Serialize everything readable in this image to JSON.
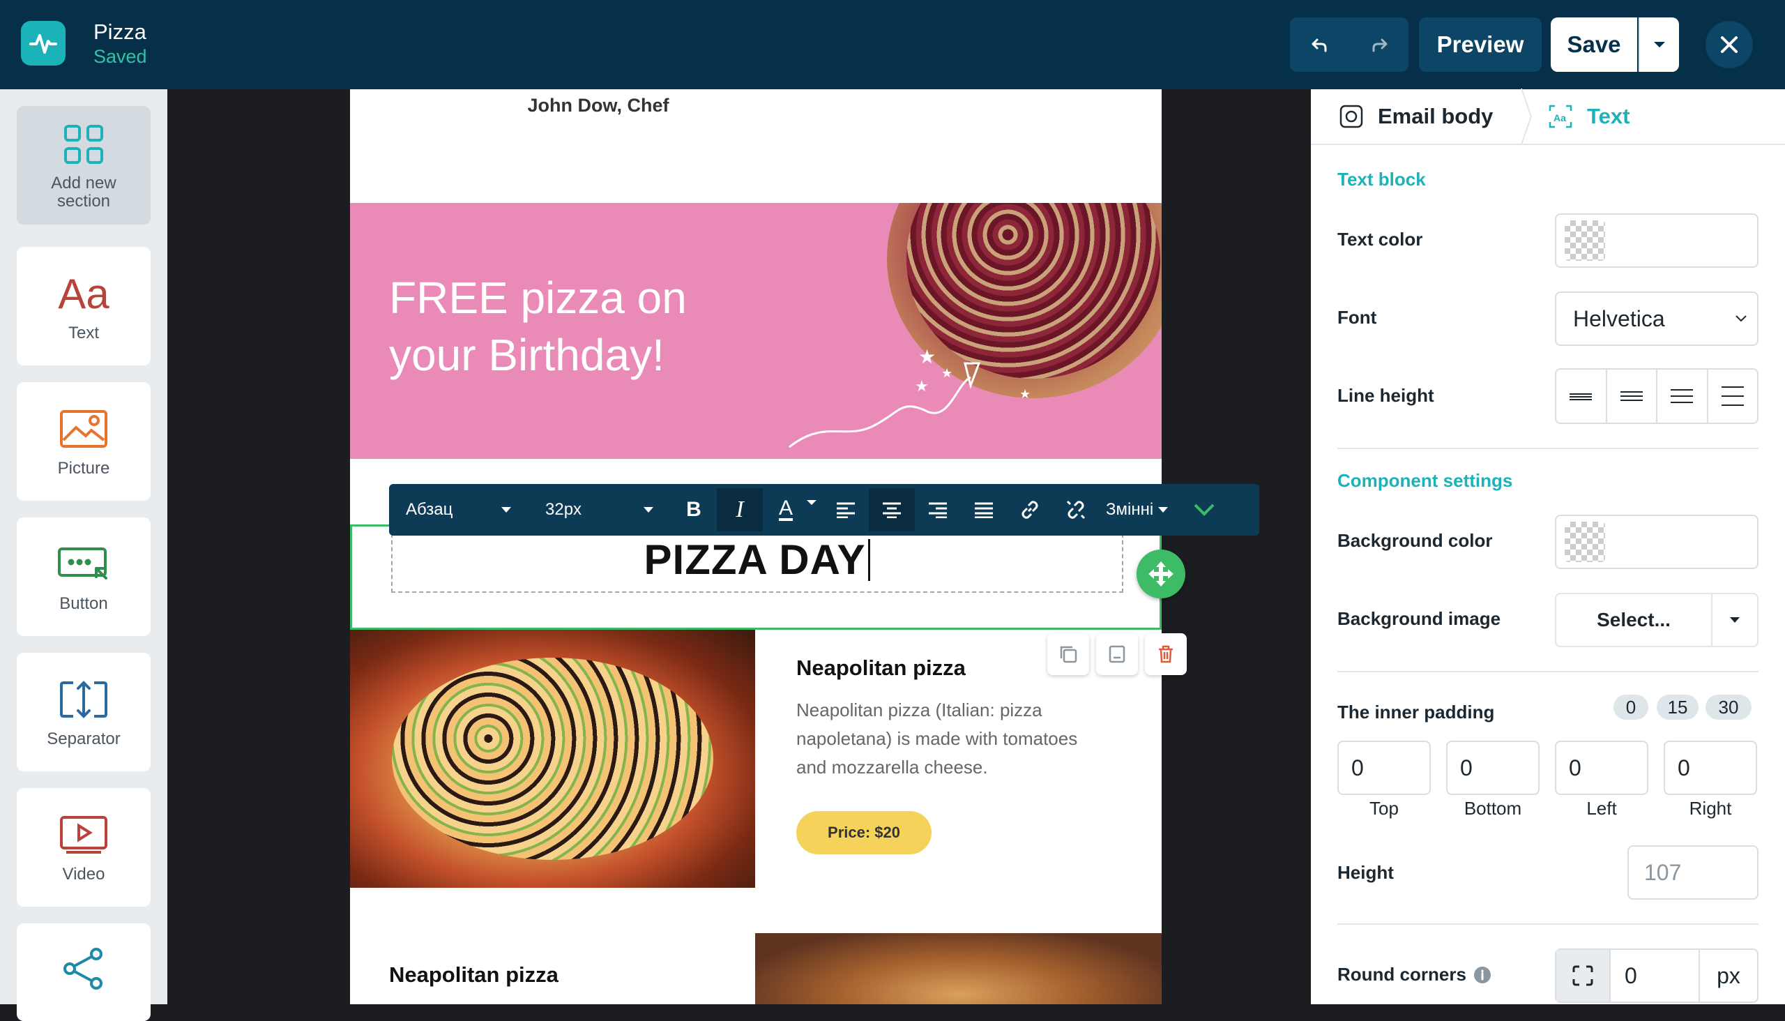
{
  "header": {
    "logo_icon": "pulse-icon",
    "title": "Pizza",
    "status": "Saved",
    "undo_icon": "undo-icon",
    "redo_icon": "redo-icon",
    "preview_label": "Preview",
    "save_label": "Save",
    "close_icon": "close-icon"
  },
  "sidebar": {
    "items": [
      {
        "label": "Add new section",
        "icon": "grid-icon"
      },
      {
        "label": "Text",
        "icon": "text-icon",
        "glyph": "Aa"
      },
      {
        "label": "Picture",
        "icon": "picture-icon"
      },
      {
        "label": "Button",
        "icon": "button-icon"
      },
      {
        "label": "Separator",
        "icon": "separator-icon"
      },
      {
        "label": "Video",
        "icon": "video-icon"
      },
      {
        "label": "",
        "icon": "share-icon"
      }
    ]
  },
  "email": {
    "chef": "John Dow, Chef",
    "banner_text": "FREE pizza on your Birthday!",
    "title": "PIZZA DAY",
    "item1": {
      "title": "Neapolitan pizza",
      "description": "Neapolitan pizza (Italian: pizza napoletana) is made with tomatoes and mozzarella cheese.",
      "price": "Price: $20"
    },
    "item2": {
      "title": "Neapolitan pizza"
    }
  },
  "text_toolbar": {
    "paragraph": "Абзац",
    "font_size": "32px",
    "bold": "B",
    "italic": "I",
    "color": "A",
    "variables": "Змінні"
  },
  "panel": {
    "tabs": [
      {
        "label": "Email body",
        "icon": "email-body-icon"
      },
      {
        "label": "Text",
        "icon": "text-settings-icon"
      }
    ],
    "text_block_heading": "Text block",
    "text_color_label": "Text color",
    "font_label": "Font",
    "font_value": "Helvetica",
    "line_height_label": "Line height",
    "component_settings_heading": "Component settings",
    "background_color_label": "Background color",
    "background_image_label": "Background image",
    "background_image_value": "Select...",
    "inner_padding_label": "The inner padding",
    "padding_presets": [
      "0",
      "15",
      "30"
    ],
    "padding": [
      {
        "label": "Top",
        "value": "0"
      },
      {
        "label": "Bottom",
        "value": "0"
      },
      {
        "label": "Left",
        "value": "0"
      },
      {
        "label": "Right",
        "value": "0"
      }
    ],
    "height_label": "Height",
    "height_placeholder": "107",
    "round_corners_label": "Round corners",
    "round_corners_value": "0",
    "round_corners_unit": "px"
  },
  "colors": {
    "header_bg": "#06304a",
    "accent": "#1bb3b9",
    "selection": "#3dbb66",
    "banner": "#ea8bb7",
    "price": "#f5d25a"
  }
}
